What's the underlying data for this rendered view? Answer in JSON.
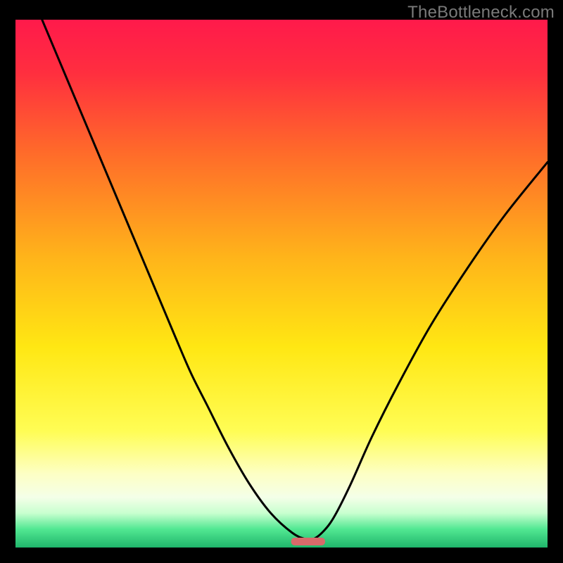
{
  "watermark": "TheBottleneck.com",
  "chart_data": {
    "type": "line",
    "title": "",
    "xlabel": "",
    "ylabel": "",
    "xlim": [
      0,
      100
    ],
    "ylim": [
      0,
      100
    ],
    "grid": false,
    "background_gradient": {
      "stops": [
        {
          "offset": 0.0,
          "color": "#ff1a4b"
        },
        {
          "offset": 0.1,
          "color": "#ff2e3f"
        },
        {
          "offset": 0.25,
          "color": "#ff6a2a"
        },
        {
          "offset": 0.45,
          "color": "#ffb41a"
        },
        {
          "offset": 0.62,
          "color": "#ffe713"
        },
        {
          "offset": 0.78,
          "color": "#fffd55"
        },
        {
          "offset": 0.86,
          "color": "#fdffc4"
        },
        {
          "offset": 0.905,
          "color": "#f4ffe8"
        },
        {
          "offset": 0.935,
          "color": "#c8ffcf"
        },
        {
          "offset": 0.965,
          "color": "#52e892"
        },
        {
          "offset": 1.0,
          "color": "#1fb56b"
        }
      ]
    },
    "series": [
      {
        "name": "bottleneck-curve",
        "color": "#000000",
        "x": [
          5,
          10,
          15,
          20,
          25,
          30,
          33,
          36,
          40,
          44,
          48,
          52,
          54.5,
          56,
          58,
          60,
          63,
          67,
          72,
          78,
          85,
          92,
          100
        ],
        "y": [
          100,
          88,
          76,
          64,
          52,
          40,
          33,
          27,
          19,
          12,
          6.5,
          2.8,
          1.6,
          1.6,
          3.2,
          6,
          12,
          21,
          31,
          42,
          53,
          63,
          73
        ]
      }
    ],
    "marker": {
      "name": "optimal-marker",
      "color": "#d86a6a",
      "x_center": 55,
      "x_halfwidth": 3.2,
      "y": 1.2
    }
  }
}
